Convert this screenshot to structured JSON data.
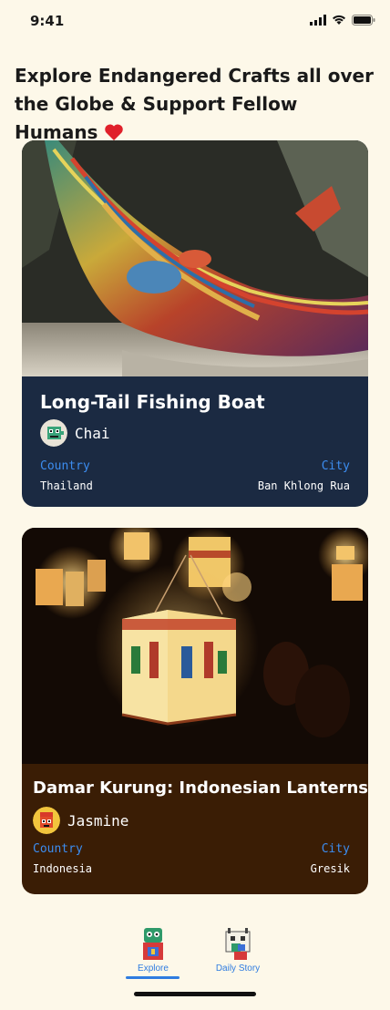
{
  "status_bar": {
    "time": "9:41"
  },
  "headline": "Explore Endangered Crafts all over the Globe & Support Fellow Humans",
  "cards": [
    {
      "title": "Long-Tail Fishing Boat",
      "author": "Chai",
      "country_label": "Country",
      "city_label": "City",
      "country": "Thailand",
      "city": "Ban Khlong Rua",
      "accent": "#1b2a42"
    },
    {
      "title": "Damar Kurung: Indonesian Lanterns",
      "author": "Jasmine",
      "country_label": "Country",
      "city_label": "City",
      "country": "Indonesia",
      "city": "Gresik",
      "accent": "#3a1d05"
    }
  ],
  "tabs": [
    {
      "label": "Explore",
      "active": true
    },
    {
      "label": "Daily Story",
      "active": false
    }
  ],
  "colors": {
    "background": "#fdf8e9",
    "link": "#3c8df0",
    "heart": "#e0202a"
  }
}
